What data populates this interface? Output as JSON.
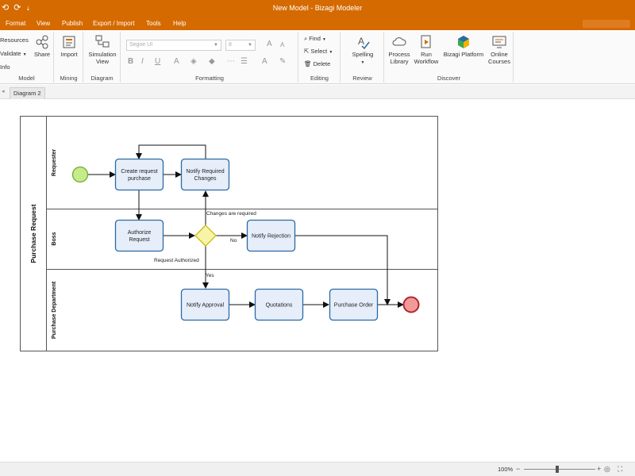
{
  "window": {
    "title": "New Model - Bizagi Modeler"
  },
  "menu": [
    "Format",
    "View",
    "Publish",
    "Export / Import",
    "Tools",
    "Help"
  ],
  "ribbon": {
    "model": {
      "resources": "Resources",
      "validate": "Validate",
      "info": "Info",
      "share": "Share",
      "label": "Model"
    },
    "mining": {
      "import": "Import",
      "label": "Mining"
    },
    "diagram": {
      "simulation": "Simulation View",
      "label": "Diagram"
    },
    "formatting": {
      "font": "Segoe UI",
      "size": "8",
      "label": "Formatting"
    },
    "editing": {
      "find": "Find",
      "select": "Select",
      "delete": "Delete",
      "label": "Editing"
    },
    "review": {
      "spelling": "Spelling",
      "label": "Review"
    },
    "discover": {
      "process_library": "Process Library",
      "run_workflow": "Run Workflow",
      "platform": "Bizagi Platform",
      "courses": "Online Courses",
      "label": "Discover"
    }
  },
  "tabs": {
    "active": "Diagram 2"
  },
  "diagram": {
    "pool": "Purchase Request",
    "lanes": [
      "Requester",
      "Boss",
      "Purchase Department"
    ],
    "tasks": {
      "create": [
        "Create request",
        "purchase"
      ],
      "notify_changes": [
        "Notify Required",
        "Changes"
      ],
      "authorize": [
        "Authorize",
        "Request"
      ],
      "rejection": "Notify Rejection",
      "approval": "Notify Approval",
      "quotations": "Quotations",
      "order": "Purchase Order"
    },
    "labels": {
      "changes": "Changes are required",
      "no": "No",
      "authorized": "Request Authorized",
      "yes": "Yes"
    }
  },
  "status": {
    "zoom": "100%"
  },
  "colors": {
    "brand": "#d56a00",
    "task_fill": "#e6eefa",
    "task_stroke": "#2b6aa6",
    "gateway": "#f7f3a8",
    "start": "#c5eb8a",
    "end": "#f29a9a"
  }
}
